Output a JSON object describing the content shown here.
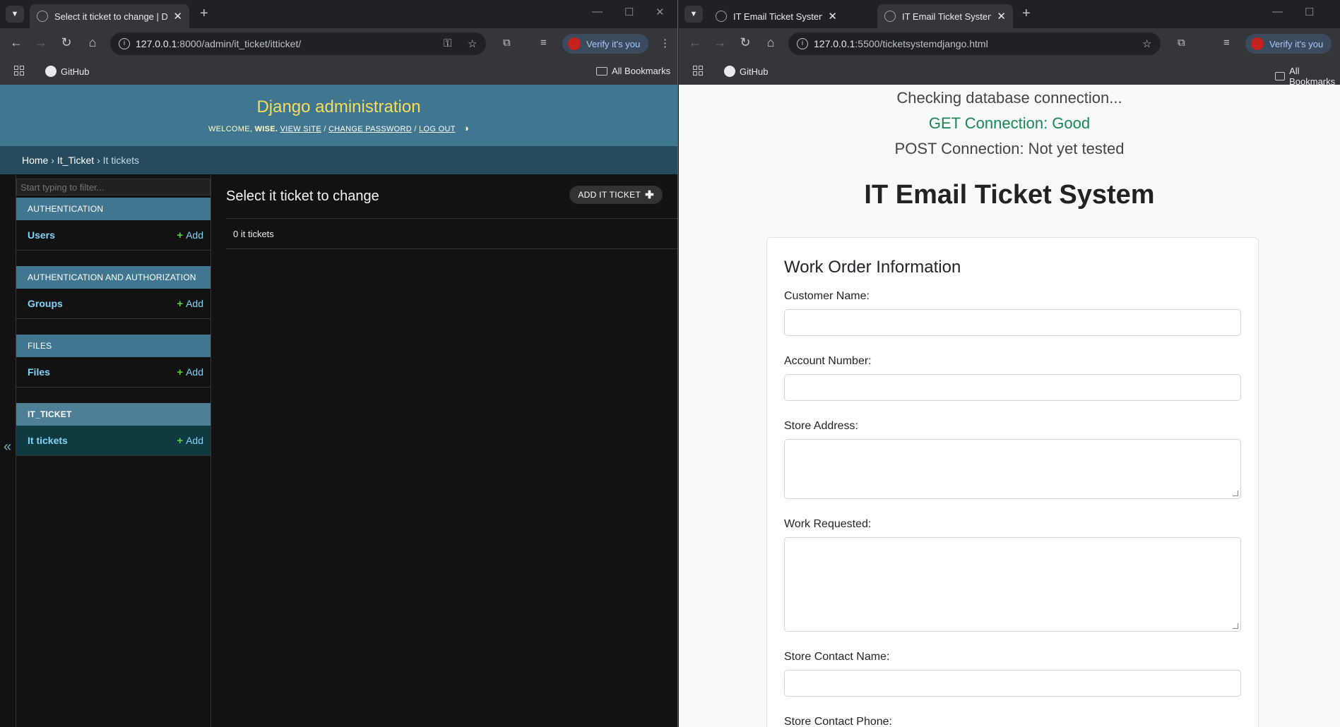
{
  "left": {
    "tab": {
      "title": "Select it ticket to change | Django site admin"
    },
    "url": {
      "host": "127.0.0.1",
      "rest": ":8000/admin/it_ticket/itticket/"
    },
    "verify": "Verify it's you",
    "bookmarks": {
      "github": "GitHub",
      "all": "All Bookmarks"
    },
    "admin": {
      "brand": "Django administration",
      "welcome": "WELCOME,",
      "user": "WISE.",
      "view_site": "VIEW SITE",
      "change_password": "CHANGE PASSWORD",
      "log_out": "LOG OUT",
      "sep": "/",
      "crumbs": {
        "home": "Home",
        "app": "It_Ticket",
        "model": "It tickets",
        "sep": "›"
      },
      "filter_placeholder": "Start typing to filter...",
      "collapse": "«",
      "modules": [
        {
          "caption": "AUTHENTICATION",
          "model": "Users",
          "add": "Add"
        },
        {
          "caption": "AUTHENTICATION AND AUTHORIZATION",
          "model": "Groups",
          "add": "Add"
        },
        {
          "caption": "FILES",
          "model": "Files",
          "add": "Add"
        },
        {
          "caption": "IT_TICKET",
          "model": "It tickets",
          "add": "Add"
        }
      ],
      "page_title": "Select it ticket to change",
      "add_button": "ADD IT TICKET",
      "count": "0 it tickets"
    }
  },
  "right": {
    "tabs": [
      "IT Email Ticket System",
      "IT Email Ticket System"
    ],
    "url": {
      "host": "127.0.0.1",
      "rest": ":5500/ticketsystemdjango.html"
    },
    "verify": "Verify it's you",
    "bookmarks": {
      "github": "GitHub",
      "all": "All Bookmarks"
    },
    "status": {
      "checking": "Checking database connection...",
      "get": "GET Connection: Good",
      "post": "POST Connection: Not yet tested"
    },
    "heading": "IT Email Ticket System",
    "card_title": "Work Order Information",
    "fields": {
      "customer_name": "Customer Name:",
      "account_number": "Account Number:",
      "store_address": "Store Address:",
      "work_requested": "Work Requested:",
      "store_contact_name": "Store Contact Name:",
      "store_contact_phone": "Store Contact Phone:"
    }
  },
  "colors": {
    "django_header": "#417690",
    "django_brand": "#f5dd5d",
    "django_breadcrumbs": "#264b5d",
    "status_good": "#198754"
  }
}
